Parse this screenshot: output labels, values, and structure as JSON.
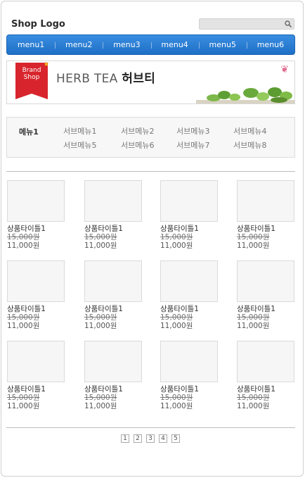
{
  "header": {
    "logo": "Shop Logo",
    "search_placeholder": "",
    "search_icon": "search-icon"
  },
  "nav": {
    "items": [
      "menu1",
      "menu2",
      "menu3",
      "menu4",
      "menu5",
      "menu6"
    ]
  },
  "banner": {
    "ribbon_line1": "Brand",
    "ribbon_line2": "Shop",
    "title_en": "HERB TEA",
    "title_ko": "허브티"
  },
  "submenu": {
    "title": "메뉴1",
    "links": [
      "서브메뉴1",
      "서브메뉴2",
      "서브메뉴3",
      "서브메뉴4",
      "서브메뉴5",
      "서브메뉴6",
      "서브메뉴7",
      "서브메뉴8"
    ]
  },
  "products": [
    {
      "title": "상품타이틀1",
      "old_price": "15,000원",
      "price": "11,000원"
    },
    {
      "title": "상품타이틀1",
      "old_price": "15,000원",
      "price": "11,000원"
    },
    {
      "title": "상품타이틀1",
      "old_price": "15,000원",
      "price": "11,000원"
    },
    {
      "title": "상품타이틀1",
      "old_price": "15,000원",
      "price": "11,000원"
    },
    {
      "title": "상품타이틀1",
      "old_price": "15,000원",
      "price": "11,000원"
    },
    {
      "title": "상품타이틀1",
      "old_price": "15,000원",
      "price": "11,000원"
    },
    {
      "title": "상품타이틀1",
      "old_price": "15,000원",
      "price": "11,000원"
    },
    {
      "title": "상품타이틀1",
      "old_price": "15,000원",
      "price": "11,000원"
    },
    {
      "title": "상품타이틀1",
      "old_price": "15,000원",
      "price": "11,000원"
    },
    {
      "title": "상품타이틀1",
      "old_price": "15,000원",
      "price": "11,000원"
    },
    {
      "title": "상품타이틀1",
      "old_price": "15,000원",
      "price": "11,000원"
    },
    {
      "title": "상품타이틀1",
      "old_price": "15,000원",
      "price": "11,000원"
    }
  ],
  "pagination": {
    "pages": [
      "1",
      "2",
      "3",
      "4",
      "5"
    ]
  },
  "colors": {
    "nav_blue": "#1f6fc7",
    "ribbon_red": "#d8252d"
  }
}
